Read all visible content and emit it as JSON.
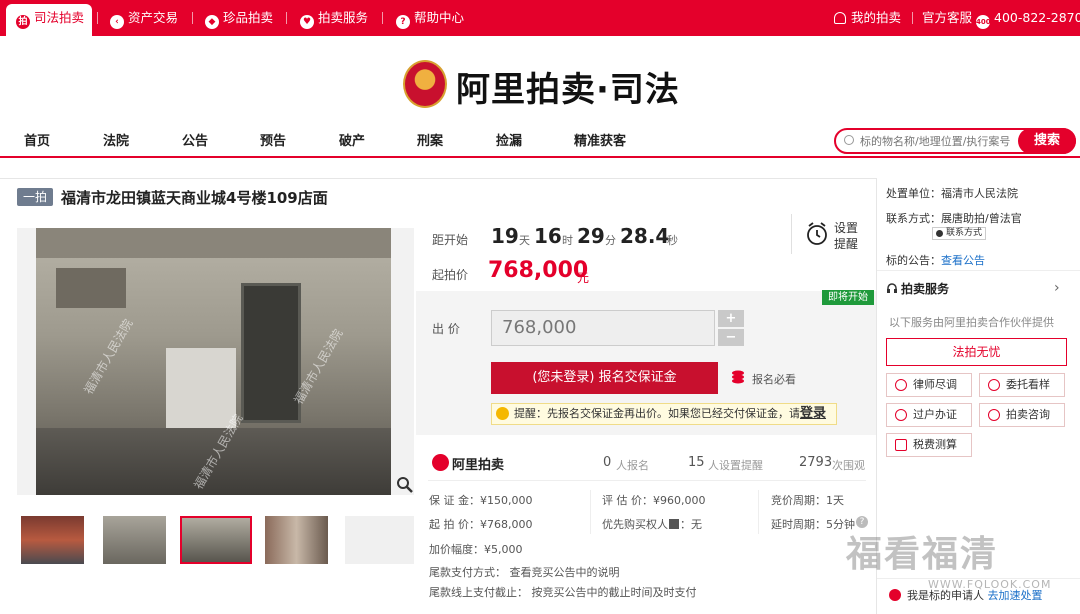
{
  "topnav": {
    "items": [
      "司法拍卖",
      "资产交易",
      "珍品拍卖",
      "拍卖服务",
      "帮助中心"
    ],
    "my_auction": "我的拍卖",
    "service": "官方客服",
    "phone": "400-822-2870"
  },
  "logo": {
    "text": "阿里拍卖·司法"
  },
  "mainnav": {
    "items": [
      "首页",
      "法院",
      "公告",
      "预告",
      "破产",
      "刑案",
      "捡漏",
      "精准获客"
    ]
  },
  "search": {
    "placeholder": "标的物名称/地理位置/执行案号",
    "button": "搜索"
  },
  "item": {
    "tag": "一拍",
    "title": "福清市龙田镇蓝天商业城4号楼109店面",
    "countdown_label": "距开始",
    "days": "19",
    "days_unit": "天",
    "hours": "16",
    "hours_unit": "时",
    "minutes": "29",
    "minutes_unit": "分",
    "seconds": "28.4",
    "seconds_unit": "秒",
    "reminder": [
      "设置",
      "提醒"
    ],
    "start_price_label": "起拍价",
    "start_price": "768,000",
    "price_unit": "元",
    "soon_badge": "即将开始",
    "bid_label": "出 价",
    "bid_value": "768,000",
    "plus": "+",
    "minus": "−",
    "apply_button": "(您未登录) 报名交保证金",
    "must_read": "报名必看",
    "tip": "提醒：先报名交保证金再出价。如果您已经交付保证金，请",
    "tip_login": "登录",
    "platform": "阿里拍卖",
    "signups": "0",
    "signups_unit": "人报名",
    "reminders": "15",
    "reminders_unit": "人设置提醒",
    "views": "2793",
    "views_unit": "次围观",
    "deposit": "保 证 金：¥150,000",
    "start_price_info": "起 拍 价：¥768,000",
    "increment": "加价幅度：¥5,000",
    "valuation": "评 估 价：¥960,000",
    "priority": "优先购买权人",
    "priority_value": "：无",
    "bid_cycle": "竞价周期：1天",
    "delay_cycle": "延时周期：5分钟",
    "final_payment": "尾款支付方式：  查看竞买公告中的说明",
    "online_payment": "尾款线上支付截止：  按竞买公告中的截止时间及时支付",
    "photo_watermark": "福清市人民法院"
  },
  "right_panel": {
    "unit_label": "处置单位：",
    "unit_value": "福清市人民法院",
    "contact_label": "联系方式：",
    "contact_value": "展唐助拍/曾法官",
    "contact_btn": "联系方式",
    "notice_label": "标的公告：",
    "notice_value": "查看公告",
    "service_title": "拍卖服务",
    "service_desc": "以下服务由阿里拍卖合作伙伴提供",
    "service_main": "法拍无忧",
    "services": [
      "律师尽调",
      "委托看样",
      "过户办证",
      "拍卖咨询",
      "税费测算"
    ],
    "applicant": "我是标的申请人",
    "applicant_link": "去加速处置"
  },
  "watermark": {
    "text": "福看福清",
    "url": "WWW.FQLOOK.COM"
  },
  "colors": {
    "brand_red": "#e4002b",
    "dark_red": "#c8102e",
    "green_badge": "#1f9a3b",
    "tag_gray": "#6f7c8f"
  }
}
